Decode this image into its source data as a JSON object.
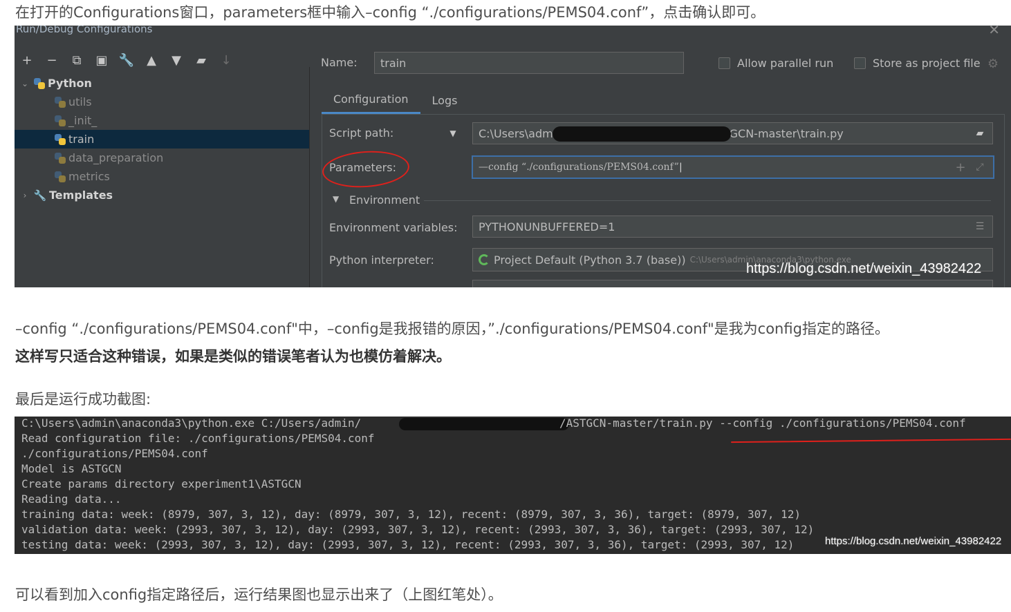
{
  "article": {
    "intro": "在打开的Configurations窗口，parameters框中输入–config “./configurations/PEMS04.conf”，点击确认即可。",
    "explain": "–config “./configurations/PEMS04.conf\"中，–config是我报错的原因，”./configurations/PEMS04.conf\"是我为config指定的路径。",
    "note_bold": "这样写只适合这种错误，如果是类似的错误笔者认为也模仿着解决。",
    "final_caption": "最后是运行成功截图:",
    "conclusion": "可以看到加入config指定路径后，运行结果图也显示出来了（上图红笔处）。"
  },
  "dialog": {
    "title": "Run/Debug Configurations",
    "name_label": "Name:",
    "name_value": "train",
    "allow_parallel": "Allow parallel run",
    "store_project": "Store as project file",
    "tabs": [
      "Configuration",
      "Logs"
    ],
    "tree": {
      "python": "Python",
      "items": [
        "utils",
        "_init_",
        "train",
        "data_preparation",
        "metrics"
      ],
      "templates": "Templates"
    },
    "script_label": "Script path:",
    "script_value_start": "C:\\Users\\adm",
    "script_value_end": "STGCN-master\\train.py",
    "params_label": "Parameters:",
    "params_value": "—config “./configurations/PEMS04.conf”",
    "env_section": "Environment",
    "env_vars_label": "Environment variables:",
    "env_vars_value": "PYTHONUNBUFFERED=1",
    "interp_label": "Python interpreter:",
    "interp_value": "Project Default (Python 3.7 (base))",
    "interp_path": "C:\\Users\\admin\\anaconda3\\python.exe",
    "watermark": "https://blog.csdn.net/weixin_43982422"
  },
  "console": {
    "lines": [
      "C:\\Users\\admin\\anaconda3\\python.exe C:/Users/admin/",
      "Read configuration file: ./configurations/PEMS04.conf",
      "./configurations/PEMS04.conf",
      "Model is ASTGCN",
      "Create params directory experiment1\\ASTGCN",
      "Reading data...",
      "training data: week: (8979, 307, 3, 12), day: (8979, 307, 3, 12), recent: (8979, 307, 3, 36), target: (8979, 307, 12)",
      "validation data: week: (2993, 307, 3, 12), day: (2993, 307, 3, 12), recent: (2993, 307, 3, 36), target: (2993, 307, 12)",
      "testing data: week: (2993, 307, 3, 12), day: (2993, 307, 3, 12), recent: (2993, 307, 3, 36), target: (2993, 307, 12)"
    ],
    "line0_tail": "/ASTGCN-master/train.py --config ./configurations/PEMS04.conf",
    "watermark": "https://blog.csdn.net/weixin_43982422"
  },
  "colors": {
    "ide_bg": "#3c3f41",
    "selection": "#0d293e",
    "accent": "#4a88c7",
    "annotation_red": "#e0201b"
  }
}
